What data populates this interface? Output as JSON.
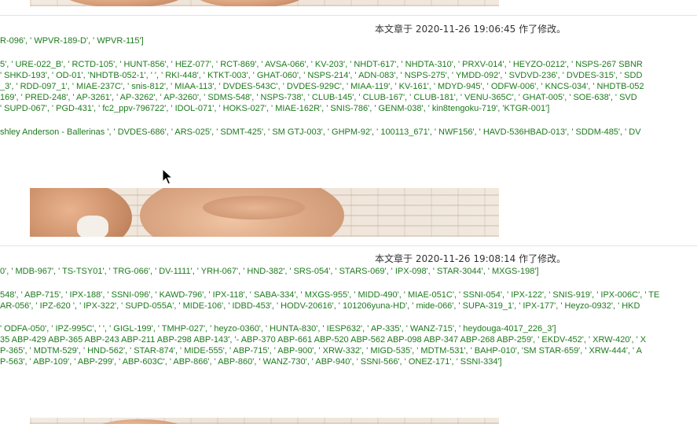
{
  "section1": {
    "modified_note": "本文章于 2020-11-26 19:06:45 作了修改。",
    "lines": [
      "R-096', ' WPVR-189-D', ' WPVR-115']",
      "5', ' URE-022_B', ' RCTD-105', ' HUNT-856', ' HEZ-077', ' RCT-869', ' AVSA-066', ' KV-203', ' NHDT-617', ' NHDTA-310', ' PRXV-014', ' HEYZO-0212', ' NSPS-267 SBNR",
      "' SHKD-193', ' OD-01', 'NHDTB-052-1', ' ', ' RKI-448', ' KTKT-003', ' GHAT-060', ' NSPS-214', ' ADN-083', ' NSPS-275', ' YMDD-092', ' SVDVD-236', ' DVDES-315', ' SDD",
      "_3', ' RDD-097_1', ' MIAE-237C', ' snis-812', ' MIAA-113', ' DVDES-543C', ' DVDES-929C', ' MIAA-119', ' KV-161', ' MDYD-945', ' ODFW-006', ' KNCS-034', ' NHDTB-052",
      "169', ' PRED-248', ' AP-3261', ' AP-3262', ' AP-3260', ' SDMS-548', ' NSPS-738', ' CLUB-145', ' CLUB-167', ' CLUB-181', ' VENU-365C', ' GHAT-005', ' SOE-638', ' SVD",
      "' SUPD-067', ' PGD-431', ' fc2_ppv-796722', ' IDOL-071', ' HOKS-027', ' MIAE-162R', ' SNIS-786', ' GENM-038', ' kin8tengoku-719', 'KTGR-001']",
      "",
      "shley Anderson - Ballerinas ', ' DVDES-686', ' ARS-025', ' SDMT-425', ' SM GTJ-003', ' GHPM-92', ' 100113_671', ' NWF156', ' HAVD-536HBAD-013', ' SDDM-485', ' DV"
    ]
  },
  "section2": {
    "modified_note": "本文章于 2020-11-26 19:08:14 作了修改。",
    "lines": [
      "0', ' MDB-967', ' TS-TSY01', ' TRG-066', ' DV-1111', ' YRH-067', ' HND-382', ' SRS-054', ' STARS-069', ' IPX-098', ' STAR-3044', ' MXGS-198']",
      "",
      "548', ' ABP-715', ' IPX-188', ' SSNI-096', ' KAWD-796', ' IPX-118', ' SABA-334', ' MXGS-955', ' MIDD-490', ' MIAE-051C', ' SSNI-054', ' IPX-122', ' SNIS-919', ' IPX-006C', ' TE",
      "AR-056', ' IPZ-620 ', ' IPX-322', ' SUPD-055A', ' MIDE-106', ' IDBD-453', ' HODV-20616', ' 101206yuna-HD', ' mide-066', ' SUPA-319_1', ' IPX-177', ' Heyzo-0932', ' HKD",
      "",
      "' ODFA-050', ' IPZ-995C', ' ', ' GIGL-199', ' TMHP-027', ' heyzo-0360', ' HUNTA-830', ' IESP632', ' AP-335', ' WANZ-715', ' heydouga-4017_226_3']",
      "35 ABP-429 ABP-365 ABP-243 ABP-211 ABP-298 ABP-143', '- ABP-370 ABP-661 ABP-520 ABP-562 ABP-098 ABP-347 ABP-268 ABP-259', ' EKDV-452', ' XRW-420', ' X",
      "P-365', ' MDTM-529', ' HND-562', ' STAR-874', ' MIDE-555', ' ABP-715', ' ABP-900', ' XRW-332', ' MIGD-535', ' MDTM-531', ' BAHP-010', 'SM STAR-659', ' XRW-444', ' A",
      "P-563', ' ABP-109', ' ABP-299', ' ABP-603C', ' ABP-866', ' ABP-860', ' WANZ-730', ' ABP-940', ' SSNI-566', ' ONEZ-171', ' SSNI-334']"
    ]
  }
}
